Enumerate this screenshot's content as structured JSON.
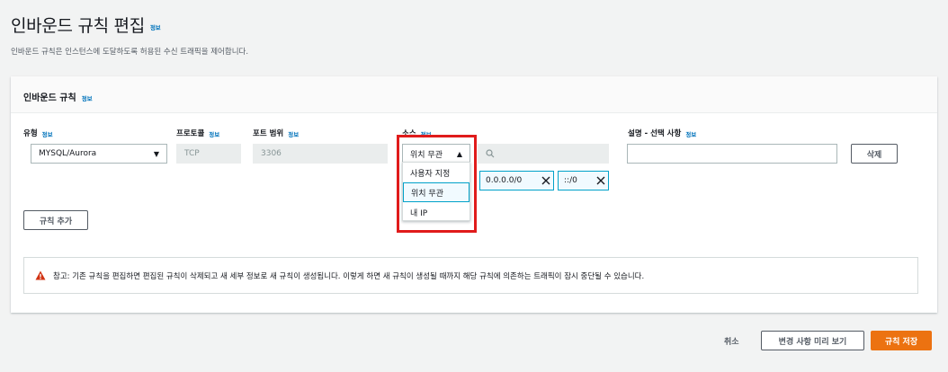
{
  "page": {
    "title": "인바운드 규칙 편집",
    "info_label": "정보",
    "description": "인바운드 규칙은 인스턴스에 도달하도록 허용된 수신 트래픽을 제어합니다."
  },
  "panel": {
    "title": "인바운드 규칙",
    "info_label": "정보"
  },
  "columns": {
    "type": "유형",
    "protocol": "프로토콜",
    "port_range": "포트 범위",
    "source": "소스",
    "description": "설명 - 선택 사항",
    "info_label": "정보"
  },
  "rule": {
    "type_value": "MYSQL/Aurora",
    "protocol_value": "TCP",
    "port_value": "3306",
    "source_value": "위치 무관",
    "source_search_placeholder": "",
    "description_value": "",
    "delete_label": "삭제",
    "cidr_tokens": [
      "0.0.0.0/0",
      "::/0"
    ]
  },
  "source_dropdown": {
    "options": [
      "사용자 지정",
      "위치 무관",
      "내 IP"
    ],
    "selected": "위치 무관"
  },
  "add_rule_label": "규칙 추가",
  "alert": {
    "text": "참고: 기존 규칙을 편집하면 편집된 규칙이 삭제되고 새 세부 정보로 새 규칙이 생성됩니다. 이렇게 하면 새 규칙이 생성될 때까지 해당 규칙에 의존하는 트래픽이 잠시 중단될 수 있습니다."
  },
  "footer": {
    "cancel_label": "취소",
    "preview_label": "변경 사항 미리 보기",
    "save_label": "규칙 저장"
  },
  "colors": {
    "accent": "#ec7211",
    "link": "#0073bb",
    "highlight": "#e01b1b",
    "warning": "#d13212"
  }
}
